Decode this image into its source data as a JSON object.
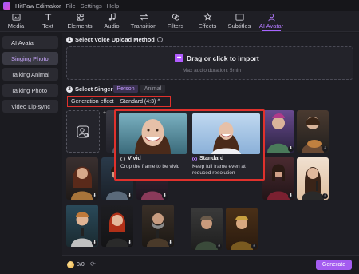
{
  "app": {
    "title": "HitPaw Edimakor",
    "menus": [
      "File",
      "Settings",
      "Help"
    ]
  },
  "toolbar": [
    {
      "label": "Media",
      "icon": "media-icon"
    },
    {
      "label": "Text",
      "icon": "text-icon"
    },
    {
      "label": "Elements",
      "icon": "elements-icon"
    },
    {
      "label": "Audio",
      "icon": "audio-icon"
    },
    {
      "label": "Transition",
      "icon": "transition-icon"
    },
    {
      "label": "Filters",
      "icon": "filters-icon"
    },
    {
      "label": "Effects",
      "icon": "effects-icon"
    },
    {
      "label": "Subtitles",
      "icon": "subtitles-icon"
    },
    {
      "label": "AI Avatar",
      "icon": "ai-avatar-icon",
      "active": true
    }
  ],
  "sidebar": {
    "items": [
      "AI Avatar",
      "Singing Photo",
      "Talking Animal",
      "Talking Photo",
      "Video Lip-sync"
    ],
    "active_index": 1
  },
  "step1": {
    "number": "1",
    "title": "Select Voice Upload Method"
  },
  "upload": {
    "label": "Drag or click to import",
    "hint": "Max audio duration: 5min"
  },
  "step2": {
    "number": "2",
    "title": "Select Singer",
    "tabs": [
      "Person",
      "Animal"
    ],
    "active_tab": "Person"
  },
  "effect": {
    "label": "Generation effect",
    "value": "Standard (4:3)",
    "chevron": "^"
  },
  "popup": {
    "options": [
      {
        "title": "Vivid",
        "desc": "Crop the frame to be vivid",
        "selected": false
      },
      {
        "title": "Standard",
        "desc": "Keep full frame even at reduced resolution",
        "selected": true
      }
    ]
  },
  "footer": {
    "credits": "0/0",
    "generate_label": "Generate"
  },
  "colors": {
    "accent": "#a45cf0",
    "highlight": "#e0312c"
  }
}
